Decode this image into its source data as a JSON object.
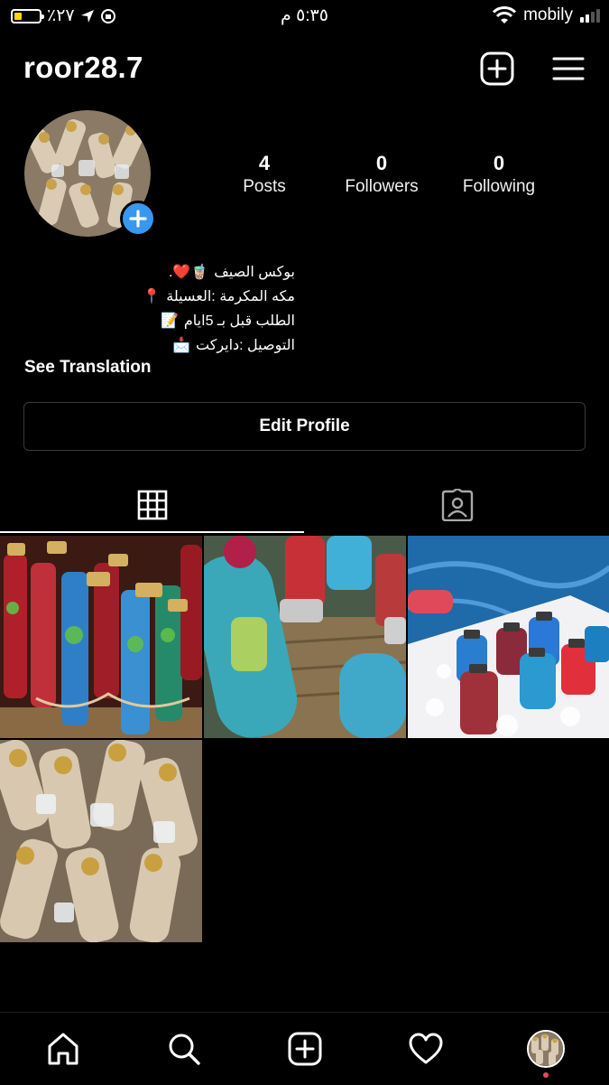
{
  "status_bar": {
    "battery_text": "٪٢٧",
    "time": "٥:٣٥ م",
    "carrier": "mobily"
  },
  "profile": {
    "username": "roor28.7",
    "stats": [
      {
        "value": "4",
        "label": "Posts"
      },
      {
        "value": "0",
        "label": "Followers"
      },
      {
        "value": "0",
        "label": "Following"
      }
    ],
    "bio_lines": [
      {
        "text": "بوكس الصيف",
        "emoji": "🧋❤️."
      },
      {
        "text": "مكه المكرمة :العسيلة",
        "emoji": "📍"
      },
      {
        "text": "الطلب قبل بـ 5ايام",
        "emoji": "📝"
      },
      {
        "text": "التوصيل :دايركت",
        "emoji": "📩"
      }
    ],
    "see_translation": "See Translation",
    "edit_profile": "Edit Profile"
  },
  "icons": {
    "header": [
      "new-post-icon",
      "menu-icon"
    ],
    "tabs": [
      "grid-icon",
      "tagged-icon"
    ],
    "bottom_nav": [
      "home-icon",
      "search-icon",
      "add-icon",
      "activity-heart-icon",
      "profile-avatar"
    ]
  },
  "posts": [
    {
      "label": "post-1"
    },
    {
      "label": "post-2"
    },
    {
      "label": "post-3"
    },
    {
      "label": "post-4"
    }
  ],
  "colors": {
    "background": "#000000",
    "accent_blue": "#3897f0",
    "battery_yellow": "#ffd60a",
    "notification_red": "#ed4956"
  }
}
